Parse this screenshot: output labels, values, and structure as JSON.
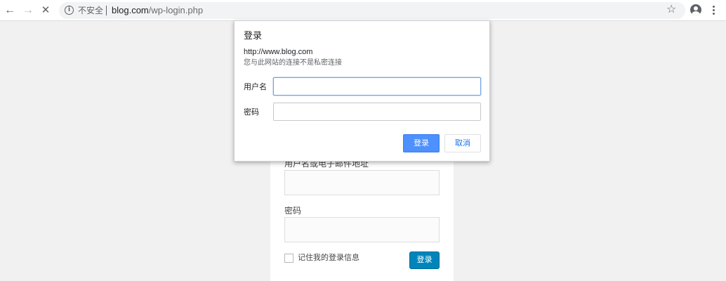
{
  "browser": {
    "back_icon": "arrow-left-icon",
    "forward_icon": "arrow-right-icon",
    "stop_icon": "close-icon",
    "security_label": "不安全",
    "url_host": "blog.com",
    "url_path": "/wp-login.php",
    "star_icon": "star-outline-icon",
    "account_icon": "account-circle-icon",
    "menu_icon": "more-vert-icon"
  },
  "auth_dialog": {
    "title": "登录",
    "origin": "http://www.blog.com",
    "warning": "您与此网站的连接不是私密连接",
    "username_label": "用户名",
    "username_value": "",
    "password_label": "密码",
    "password_value": "",
    "ok_label": "登录",
    "cancel_label": "取消",
    "ok_color": "#4d90fe"
  },
  "login_form": {
    "username_label": "用户名或电子邮件地址",
    "username_value": "",
    "password_label": "密码",
    "password_value": "",
    "remember_label": "记住我的登录信息",
    "remember_checked": false,
    "submit_label": "登录",
    "submit_color": "#0085ba"
  }
}
